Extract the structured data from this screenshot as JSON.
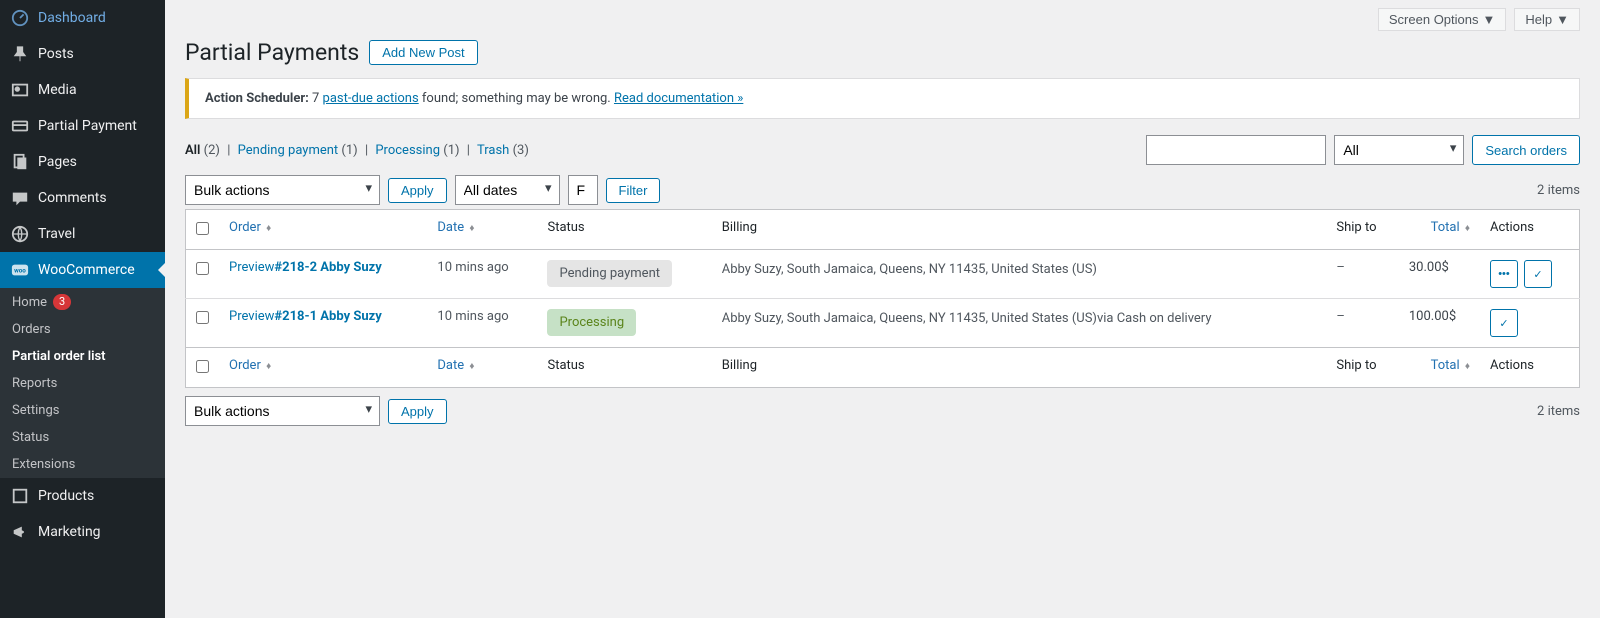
{
  "sidebar": {
    "items": [
      {
        "icon": "dashboard",
        "label": "Dashboard"
      },
      {
        "icon": "pin",
        "label": "Posts"
      },
      {
        "icon": "media",
        "label": "Media"
      },
      {
        "icon": "payment",
        "label": "Partial Payment"
      },
      {
        "icon": "pages",
        "label": "Pages"
      },
      {
        "icon": "comments",
        "label": "Comments"
      },
      {
        "icon": "travel",
        "label": "Travel"
      },
      {
        "icon": "woo",
        "label": "WooCommerce"
      },
      {
        "icon": "products",
        "label": "Products"
      },
      {
        "icon": "marketing",
        "label": "Marketing"
      }
    ],
    "submenu": [
      {
        "label": "Home",
        "badge": "3"
      },
      {
        "label": "Orders"
      },
      {
        "label": "Partial order list",
        "active": true
      },
      {
        "label": "Reports"
      },
      {
        "label": "Settings"
      },
      {
        "label": "Status"
      },
      {
        "label": "Extensions"
      }
    ]
  },
  "topbar": {
    "screen_options": "Screen Options",
    "help": "Help"
  },
  "header": {
    "title": "Partial Payments",
    "add_new": "Add New Post"
  },
  "notice": {
    "prefix": "Action Scheduler:",
    "count": "7",
    "link1": "past-due actions",
    "mid": " found; something may be wrong. ",
    "link2": "Read documentation »"
  },
  "filters": {
    "all": "All",
    "all_count": "(2)",
    "pending": "Pending payment",
    "pending_count": "(1)",
    "processing": "Processing",
    "processing_count": "(1)",
    "trash": "Trash",
    "trash_count": "(3)"
  },
  "search": {
    "cat_all": "All",
    "button": "Search orders"
  },
  "tablenav": {
    "bulk": "Bulk actions",
    "apply": "Apply",
    "all_dates": "All dates",
    "filter": "Filter",
    "customer_placeholder": "F",
    "items_count": "2 items"
  },
  "columns": {
    "order": "Order",
    "date": "Date",
    "status": "Status",
    "billing": "Billing",
    "ship_to": "Ship to",
    "total": "Total",
    "actions": "Actions"
  },
  "rows": [
    {
      "preview": "Preview",
      "order": "#218-2 Abby Suzy",
      "date": "10 mins ago",
      "status_label": "Pending payment",
      "status_class": "status-pending",
      "billing": "Abby Suzy, South Jamaica, Queens, NY 11435, United States (US)",
      "ship_to": "–",
      "total": "30.00$",
      "actions": [
        "more",
        "check"
      ]
    },
    {
      "preview": "Preview",
      "order": "#218-1 Abby Suzy",
      "date": "10 mins ago",
      "status_label": "Processing",
      "status_class": "status-processing",
      "billing": "Abby Suzy, South Jamaica, Queens, NY 11435, United States (US)via Cash on delivery",
      "ship_to": "–",
      "total": "100.00$",
      "actions": [
        "check"
      ]
    }
  ]
}
